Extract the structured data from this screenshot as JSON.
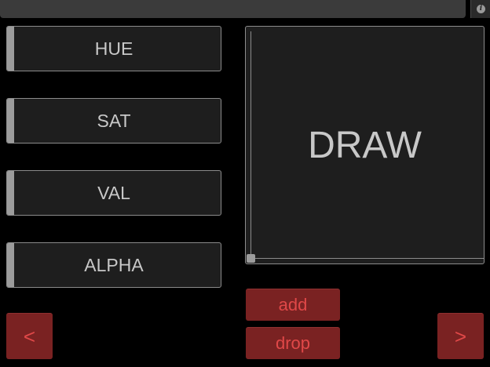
{
  "toolbar": {
    "info_icon": "info-icon"
  },
  "sliders": [
    {
      "label": "HUE",
      "value": 0
    },
    {
      "label": "SAT",
      "value": 0
    },
    {
      "label": "VAL",
      "value": 0
    },
    {
      "label": "ALPHA",
      "value": 0
    }
  ],
  "draw_pad": {
    "label": "DRAW",
    "x": 0,
    "y": 0
  },
  "buttons": {
    "add": "add",
    "drop": "drop",
    "prev": "<",
    "next": ">"
  },
  "colors": {
    "background": "#000000",
    "control": "#1e1e1e",
    "button_fill": "#7a2222",
    "button_text": "#e04848",
    "label_text": "#c8c8c8"
  }
}
